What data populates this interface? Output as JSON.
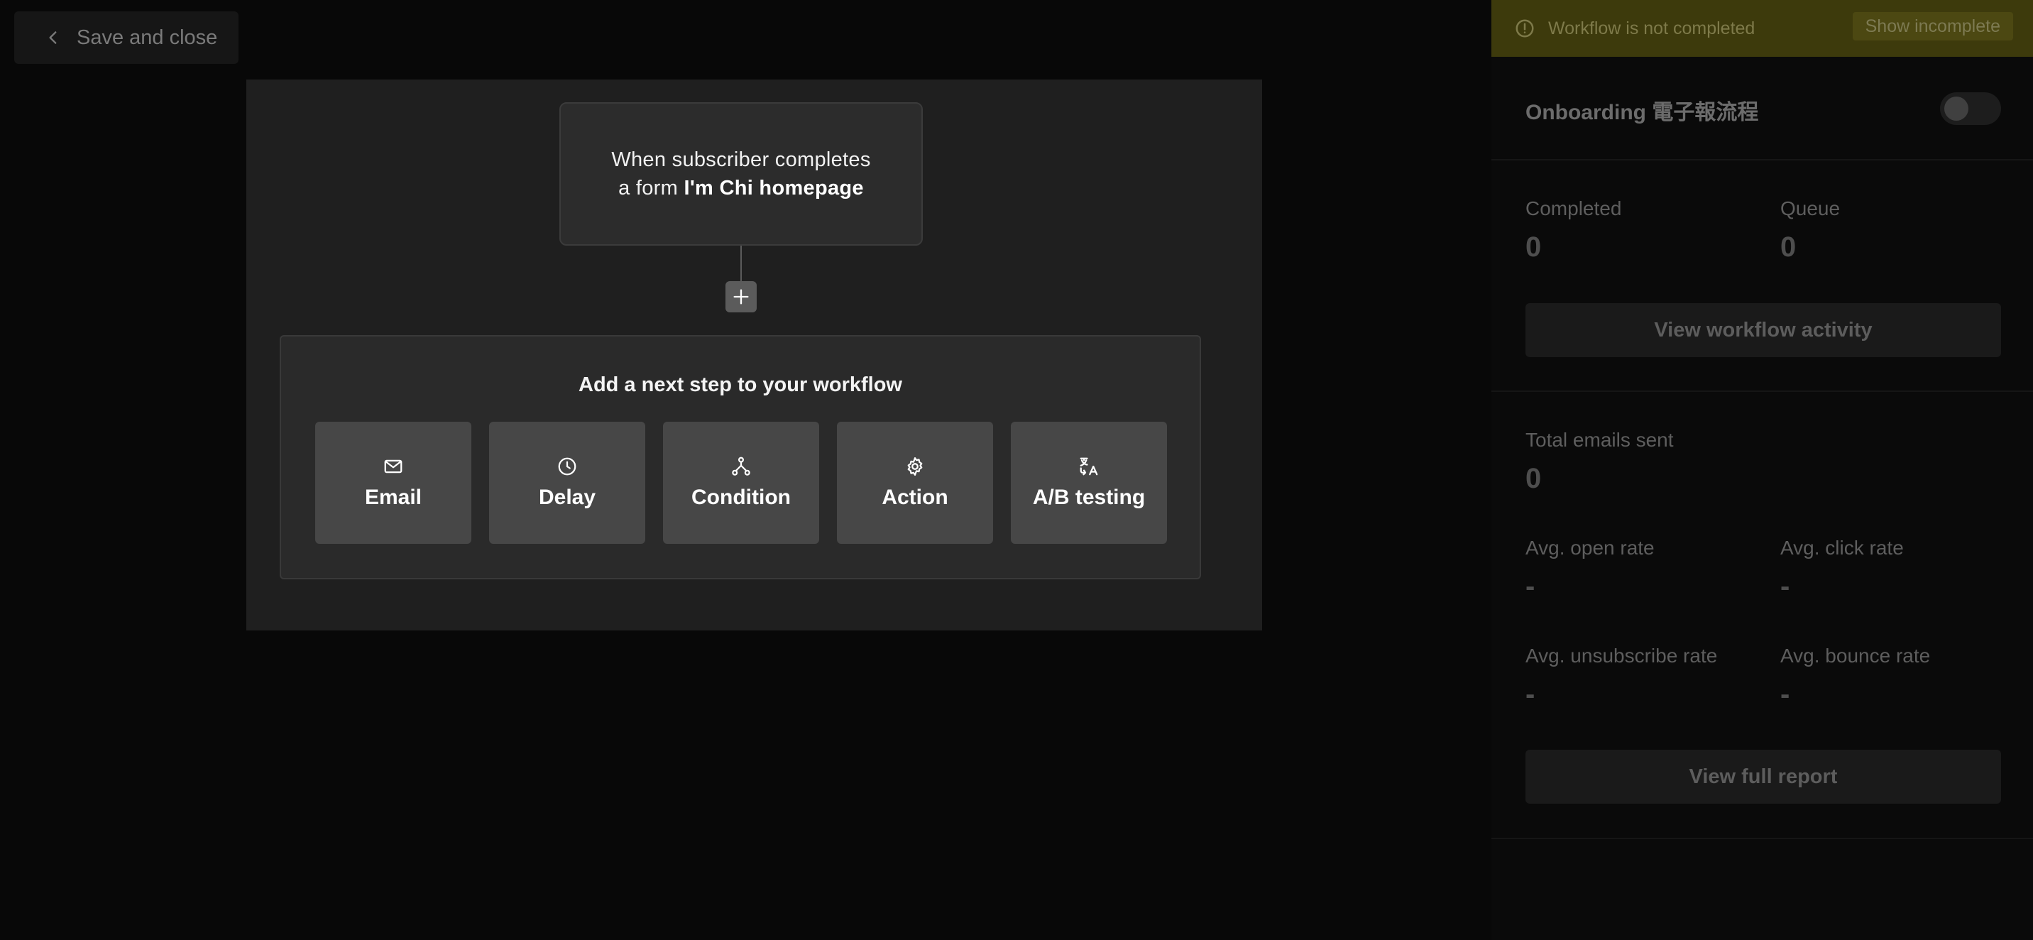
{
  "toolbar": {
    "save_close_label": "Save and close"
  },
  "canvas": {
    "trigger": {
      "prefix": "When subscriber completes a form",
      "form_name": "I'm Chi homepage"
    },
    "panel": {
      "title": "Add a next step to your workflow",
      "options": [
        {
          "label": "Email",
          "icon": "envelope-icon"
        },
        {
          "label": "Delay",
          "icon": "clock-icon"
        },
        {
          "label": "Condition",
          "icon": "branch-icon"
        },
        {
          "label": "Action",
          "icon": "gear-icon"
        },
        {
          "label": "A/B testing",
          "icon": "translate-icon"
        }
      ]
    }
  },
  "sidebar": {
    "banner": {
      "message": "Workflow is not completed",
      "button_label": "Show incomplete"
    },
    "workflow_name": "Onboarding 電子報流程",
    "toggle_enabled": false,
    "stats": {
      "completed_label": "Completed",
      "completed_value": "0",
      "queue_label": "Queue",
      "queue_value": "0",
      "activity_button": "View workflow activity",
      "total_sent_label": "Total emails sent",
      "total_sent_value": "0",
      "open_rate_label": "Avg. open rate",
      "open_rate_value": "-",
      "click_rate_label": "Avg. click rate",
      "click_rate_value": "-",
      "unsub_rate_label": "Avg. unsubscribe rate",
      "unsub_rate_value": "-",
      "bounce_rate_label": "Avg. bounce rate",
      "bounce_rate_value": "-",
      "report_button": "View full report"
    }
  },
  "colors": {
    "banner_bg": "#3d3a0c",
    "canvas_bg": "#1f1f1f",
    "option_bg": "#474747"
  }
}
